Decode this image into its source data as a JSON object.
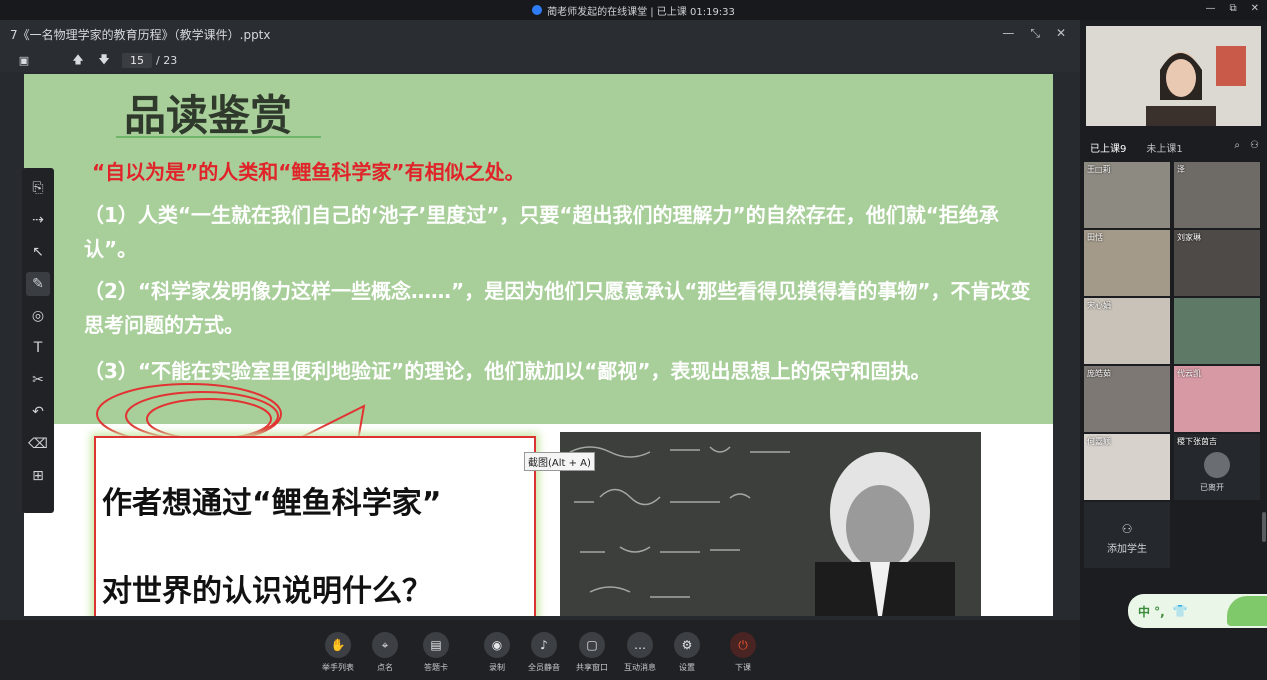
{
  "window": {
    "title": "蔺老师发起的在线课堂 | 已上课 01:19:33",
    "controls": [
      "—",
      "⧉",
      "✕"
    ]
  },
  "presentation": {
    "file_title": "7《一名物理学家的教育历程》（教学课件）.pptx",
    "head_controls": [
      "—",
      "⤡",
      "✕"
    ],
    "current_page": "15",
    "total_pages": "/ 23"
  },
  "slide": {
    "title": "品读鉴赏",
    "red_line": "“自以为是”的人类和“鲤鱼科学家”有相似之处。",
    "para1": "（1）人类“一生就在我们自己的‘池子’里度过”，只要“超出我们的理解力”的自然存在，他们就“拒绝承认”。",
    "para2": "（2）“科学家发明像力这样一些概念……”，是因为他们只愿意承认“那些看得见摸得着的事物”，不肯改变思考问题的方式。",
    "para3": "（3）“不能在实验室里便利地验证”的理论，他们就加以“鄙视”，表现出思想上的保守和固执。",
    "question1": "作者想通过“鲤鱼科学家”",
    "question2": "对世界的认识说明什么？",
    "tooltip": "截图(Alt + A)"
  },
  "left_toolbar": [
    "new-page-icon",
    "laser-pointer-icon",
    "select-arrow-icon",
    "pen-icon",
    "shapes-icon",
    "text-icon",
    "scissors-icon",
    "undo-icon",
    "eraser-icon",
    "toolbox-icon"
  ],
  "bottom_controls": [
    {
      "label": "举手列表",
      "icon": "✋"
    },
    {
      "label": "点名",
      "icon": "⌖"
    },
    {
      "label": "答题卡",
      "icon": "▤"
    },
    {
      "label": "录制",
      "icon": "◉"
    },
    {
      "label": "全员静音",
      "icon": "♪"
    },
    {
      "label": "共享窗口",
      "icon": "▢"
    },
    {
      "label": "互动消息",
      "icon": "…"
    },
    {
      "label": "设置",
      "icon": "⚙"
    },
    {
      "label": "下课",
      "icon": "⏻"
    }
  ],
  "right_panel": {
    "tabs": [
      "已上课9",
      "未上课1"
    ],
    "students": [
      {
        "name": "王□莉"
      },
      {
        "name": "泽"
      },
      {
        "name": "田恬"
      },
      {
        "name": "刘家琳"
      },
      {
        "name": "宋心娟"
      },
      {
        "name": ""
      },
      {
        "name": "庞皓茹"
      },
      {
        "name": "代云凯"
      },
      {
        "name": "何嘉颖"
      },
      {
        "name": "稷下张茵吉",
        "status": "已离开"
      }
    ],
    "add_student": "添加学生"
  },
  "ime": {
    "text": "中 °,"
  }
}
